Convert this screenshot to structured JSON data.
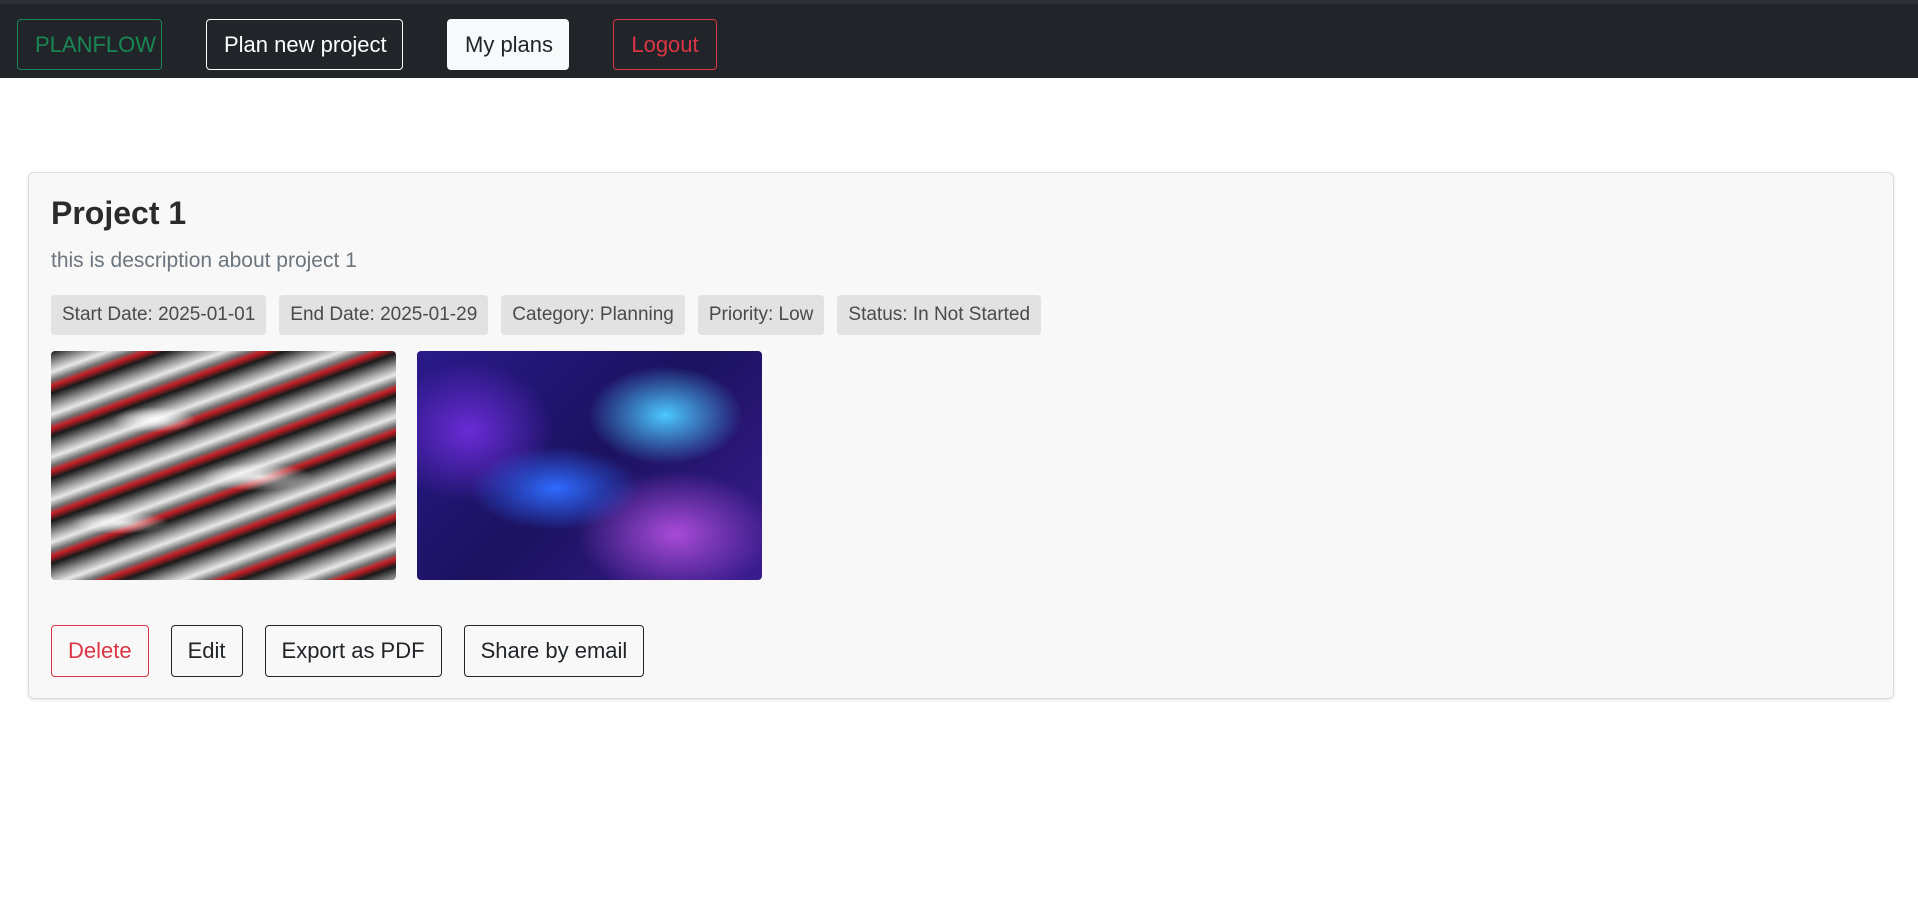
{
  "navbar": {
    "brand": "PLANFLOW",
    "plan_new": "Plan new project",
    "my_plans": "My plans",
    "logout": "Logout"
  },
  "project": {
    "title": "Project 1",
    "description": "this is description about project 1",
    "badges": {
      "start_date": "Start Date: 2025-01-01",
      "end_date": "End Date: 2025-01-29",
      "category": "Category: Planning",
      "priority": "Priority: Low",
      "status": "Status: In Not Started"
    },
    "actions": {
      "delete": "Delete",
      "edit": "Edit",
      "export_pdf": "Export as PDF",
      "share_email": "Share by email"
    }
  },
  "colors": {
    "navbar_bg": "#212529",
    "brand": "#198754",
    "danger": "#dc3545",
    "card_bg": "#f8f8f8",
    "badge_bg": "#e2e2e2"
  }
}
